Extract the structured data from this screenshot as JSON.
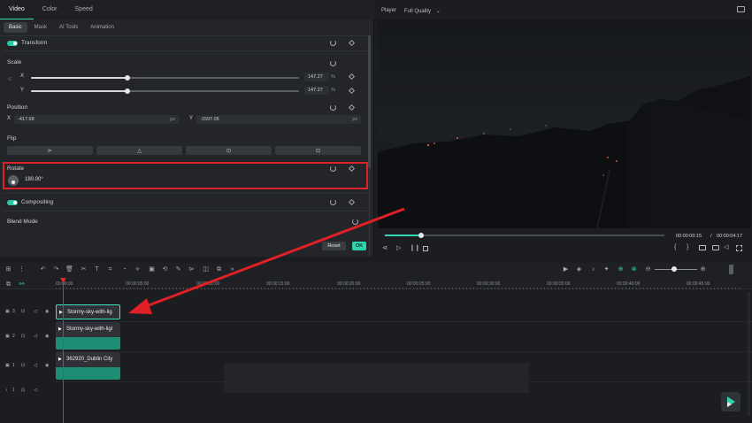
{
  "props": {
    "top_tabs": [
      "Video",
      "Color",
      "Speed"
    ],
    "sub_tabs": [
      "Basic",
      "Mask",
      "AI Tools",
      "Animation"
    ],
    "transform": {
      "title": "Transform"
    },
    "scale": {
      "title": "Scale",
      "x_label": "X",
      "x_value": "147.27",
      "x_unit": "%",
      "x_fraction": 0.36,
      "y_label": "Y",
      "y_value": "147.27",
      "y_unit": "%",
      "y_fraction": 0.36
    },
    "position": {
      "title": "Position",
      "x_label": "X",
      "x_value": "-417.68",
      "x_unit": "px",
      "y_label": "Y",
      "y_value": "-1597.05",
      "y_unit": "px"
    },
    "flip": {
      "title": "Flip"
    },
    "rotate": {
      "title": "Rotate",
      "value": "180.00°"
    },
    "compositing": {
      "title": "Compositing"
    },
    "blend_mode": {
      "title": "Blend Mode"
    },
    "reset_label": "Reset",
    "ok_label": "OK"
  },
  "player": {
    "label": "Player",
    "quality": "Full Quality",
    "current_time": "00:00:00:15",
    "separator": "/",
    "total_time": "00:00:04:17",
    "progress_fraction": 0.13
  },
  "timeline": {
    "ruler": [
      "00:00:00",
      "00:00:05:00",
      "00:00:10:00",
      "00:00:15:00",
      "00:00:20:00",
      "00:00:25:00",
      "00:00:30:00",
      "00:00:35:00",
      "00:00:40:00",
      "00:00:45:00"
    ],
    "tracks": [
      {
        "num": "3",
        "clip": "Stormy-sky-with-lig"
      },
      {
        "num": "2",
        "clip": "Stormy-sky-with-ligl"
      },
      {
        "num": "1",
        "clip": "362920_Dublin City"
      },
      {
        "num": "1"
      }
    ]
  },
  "colors": {
    "accent": "#2ed3ae",
    "highlight": "#d9232a",
    "playhead": "#d62b2f"
  },
  "icons": [
    "reset-icon",
    "keyframe-icon",
    "link-icon",
    "flip-horizontal-icon",
    "flip-vertical-icon",
    "rotate-left-icon",
    "rotate-right-icon",
    "snapshot-icon",
    "fullscreen-icon",
    "play-icon",
    "pause-icon",
    "stop-icon"
  ]
}
